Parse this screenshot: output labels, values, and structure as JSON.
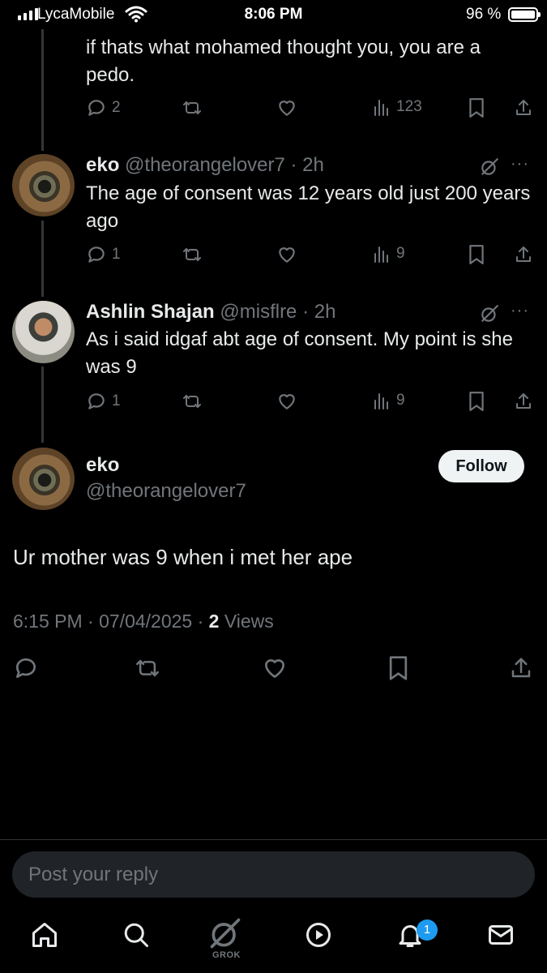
{
  "status_bar": {
    "carrier": "LycaMobile",
    "time": "8:06 PM",
    "battery": "96 %"
  },
  "thread": [
    {
      "text": "if thats what mohamed thought you, you are a pedo.",
      "stats": {
        "replies": "2",
        "views": "123"
      }
    },
    {
      "name": "eko",
      "meta": "@theorangelover7 · 2h",
      "text": "The age of consent was 12 years old just 200 years ago",
      "stats": {
        "replies": "1",
        "views": "9"
      }
    },
    {
      "name": "Ashlin Shajan",
      "meta": "@misflre · 2h",
      "text": "As i said idgaf abt age of consent. My point is she was 9",
      "stats": {
        "replies": "1",
        "views": "9"
      }
    }
  ],
  "main_post": {
    "name": "eko",
    "handle": "@theorangelover7",
    "follow_label": "Follow",
    "text": "Ur mother was 9 when i met her ape",
    "timestamp": "6:15 PM · 07/04/2025 · ",
    "views_count": "2",
    "views_label": " Views"
  },
  "reply": {
    "placeholder": "Post your reply"
  },
  "tabbar": {
    "grok_label": "GROK",
    "notifications_badge": "1"
  }
}
